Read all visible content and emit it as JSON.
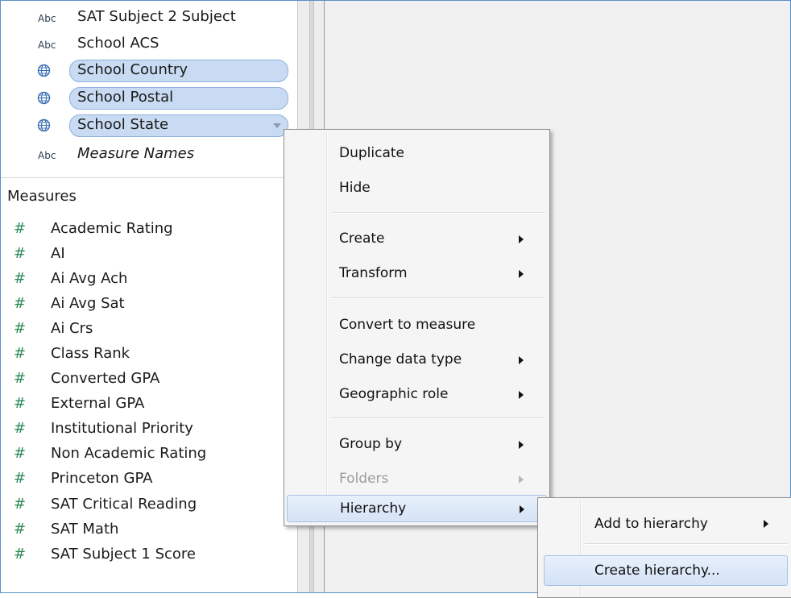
{
  "dimensions": {
    "items": [
      {
        "type": "Abc",
        "label": "SAT Subject 2 Subject"
      },
      {
        "type": "Abc",
        "label": "School ACS"
      },
      {
        "type": "globe",
        "label": "School Country"
      },
      {
        "type": "globe",
        "label": "School Postal"
      },
      {
        "type": "globe",
        "label": "School State"
      },
      {
        "type": "Abc",
        "label": "Measure Names"
      }
    ]
  },
  "measures": {
    "header": "Measures",
    "icon": "#",
    "items": [
      "Academic Rating",
      "AI",
      "Ai Avg Ach",
      "Ai Avg Sat",
      "Ai Crs",
      "Class Rank",
      "Converted GPA",
      "External GPA",
      "Institutional Priority",
      "Non Academic Rating",
      "Princeton GPA",
      "SAT Critical Reading",
      "SAT Math",
      "SAT Subject 1 Score"
    ]
  },
  "context_menu": {
    "items": [
      {
        "label": "Duplicate",
        "submenu": false
      },
      {
        "label": "Hide",
        "submenu": false
      },
      {
        "label": "Create",
        "submenu": true
      },
      {
        "label": "Transform",
        "submenu": true
      },
      {
        "label": "Convert to measure",
        "submenu": false
      },
      {
        "label": "Change data type",
        "submenu": true
      },
      {
        "label": "Geographic role",
        "submenu": true
      },
      {
        "label": "Group by",
        "submenu": true
      },
      {
        "label": "Folders",
        "submenu": true,
        "disabled": true
      },
      {
        "label": "Hierarchy",
        "submenu": true,
        "highlighted": true
      }
    ]
  },
  "hierarchy_submenu": {
    "items": [
      {
        "label": "Add to hierarchy",
        "submenu": true
      },
      {
        "label": "Create hierarchy...",
        "highlighted": true
      }
    ]
  },
  "colors": {
    "selection_pill": "#c9dbf3",
    "measure_icon": "#2f8a59",
    "menu_highlight": "#d4e3f6",
    "frame_border": "#5b8fc7"
  },
  "icons": {
    "abc": "string-type-icon",
    "globe": "globe-icon",
    "hash": "number-type-icon",
    "submenu_arrow": "submenu-arrow-icon"
  }
}
